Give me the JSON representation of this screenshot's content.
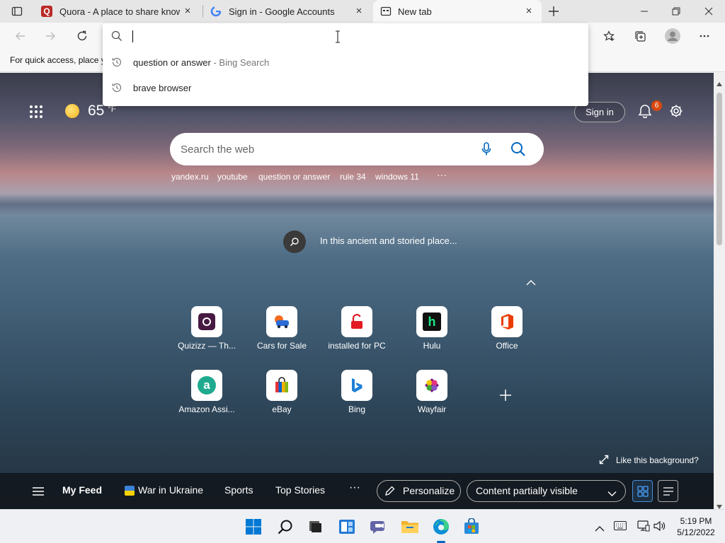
{
  "tabs": [
    {
      "title": "Quora - A place to share knowle",
      "active": false
    },
    {
      "title": "Sign in - Google Accounts",
      "active": false
    },
    {
      "title": "New tab",
      "active": true
    }
  ],
  "favorites_bar": {
    "hint": "For quick access, place y"
  },
  "address_dropdown": {
    "input_value": "",
    "suggestions": [
      {
        "text": "question or answer",
        "suffix": " - Bing Search",
        "icon": "history-icon"
      },
      {
        "text": "brave browser",
        "suffix": "",
        "icon": "history-icon"
      }
    ]
  },
  "weather": {
    "temperature": "65",
    "unit": "°F"
  },
  "sign_in": "Sign in",
  "notifications": {
    "count": "6"
  },
  "ntp_search": {
    "placeholder": "Search the web"
  },
  "quick_links": [
    "yandex.ru",
    "youtube",
    "question or answer",
    "rule 34",
    "windows 11",
    "···"
  ],
  "image_caption": "In this ancient and storied place...",
  "top_sites": [
    {
      "label": "Quizizz — Th...",
      "icon": "quizizz-icon"
    },
    {
      "label": "Cars for Sale",
      "icon": "cars-icon"
    },
    {
      "label": "installed for PC",
      "icon": "installed-icon"
    },
    {
      "label": "Hulu",
      "icon": "hulu-icon"
    },
    {
      "label": "Office",
      "icon": "office-icon"
    },
    {
      "label": "Amazon Assi...",
      "icon": "amazon-icon"
    },
    {
      "label": "eBay",
      "icon": "ebay-icon"
    },
    {
      "label": "Bing",
      "icon": "bing-icon"
    },
    {
      "label": "Wayfair",
      "icon": "wayfair-icon"
    }
  ],
  "like_background": "Like this background?",
  "feed": {
    "items": [
      "My Feed",
      "War in Ukraine",
      "Sports",
      "Top Stories",
      "···"
    ],
    "personalize": "Personalize",
    "content_visibility": "Content partially visible"
  },
  "taskbar": {
    "time": "5:19 PM",
    "date": "5/12/2022"
  },
  "colors": {
    "accent": "#0067c0",
    "badge": "#d9480f",
    "tab_bar": "#e6e6e6",
    "feed_bar": "#12161c"
  }
}
